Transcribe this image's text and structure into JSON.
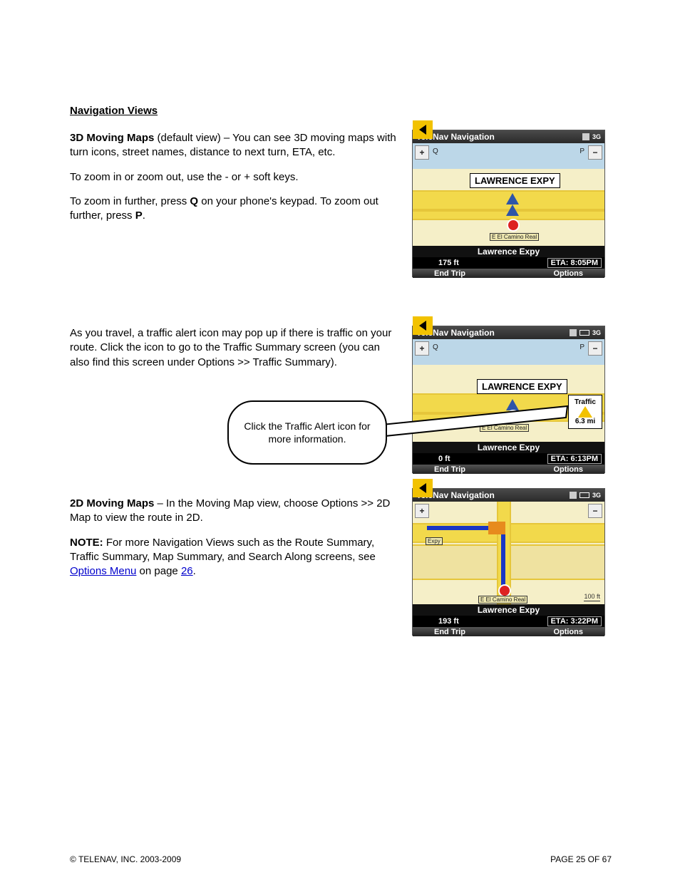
{
  "sections": {
    "viewsHeading": "Navigation Views",
    "para1": "3D Moving Maps",
    "para1b": " (default view) – You can see 3D moving maps with turn icons, street names, distance to next turn, ETA, etc.",
    "zoomNote": "To zoom in or zoom out, use the - or + soft keys.",
    "zoomNote2": "To zoom in further, press ",
    "zoomNote2_key": "Q",
    "zoomNote2_after": " on your phone's keypad. To zoom out further, press ",
    "zoomNote2_p": "P",
    "zoomNote2_end": ".",
    "trafficPara": "As you travel, a traffic alert icon may pop up if there is traffic on your route. Click the icon to go to the Traffic Summary screen (you can also find this screen under Options >> Traffic Summary).",
    "calloutText": "Click the Traffic Alert icon for more information.",
    "map2dHeading": "2D Moving Maps",
    "map2dPara": " – In the Moving Map view, choose Options >> 2D Map to view the route in 2D.",
    "noteLabel": "NOTE:",
    "noteBody": " For more Navigation Views such as the Route Summary, Traffic Summary, Map Summary, and Search Along screens, see ",
    "noteLink": "Options Menu",
    "noteLinkAfter": " on page ",
    "noteLinkPage": "26",
    "noteEnd": "."
  },
  "screenshots": {
    "title": "TeleNav Navigation",
    "zoomIn": "+",
    "zoomOut": "−",
    "labelQ": "Q",
    "labelP": "P",
    "signMain": "LAWRENCE EXPY",
    "smallSign": "E El Camino Real",
    "streetName": "Lawrence Expy",
    "endTrip": "End Trip",
    "options": "Options",
    "ss1": {
      "dist": "175 ft",
      "eta": "ETA: 8:05PM"
    },
    "ss2": {
      "dist": "0 ft",
      "eta": "ETA: 6:13PM",
      "trafficLabel": "Traffic",
      "trafficDist": "6.3 mi"
    },
    "ss3": {
      "dist": "193 ft",
      "eta": "ETA: 3:22PM",
      "scale": "100 ft",
      "smallExpy": "Expy"
    }
  },
  "footer": {
    "copyright": "© TELENAV, INC. 2003-2009",
    "page": "PAGE 25 OF 67"
  }
}
